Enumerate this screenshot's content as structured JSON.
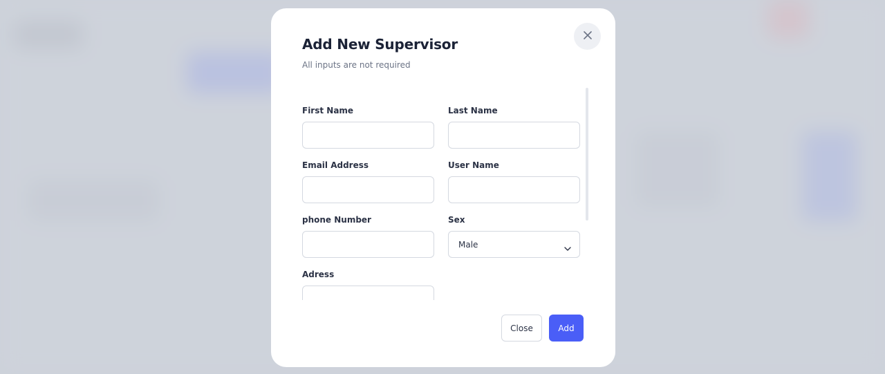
{
  "colors": {
    "accent": "#4a5ef7",
    "title": "#1b2236",
    "subtitle": "#6b7385",
    "border": "#d4d8e0"
  },
  "modal": {
    "title": "Add New Supervisor",
    "subtitle": "All inputs are not required",
    "close_icon": "close-icon"
  },
  "form": {
    "first_name": {
      "label": "First Name",
      "value": ""
    },
    "last_name": {
      "label": "Last Name",
      "value": ""
    },
    "email": {
      "label": "Email Address",
      "value": ""
    },
    "user_name": {
      "label": "User Name",
      "value": ""
    },
    "phone": {
      "label": "phone Number",
      "value": ""
    },
    "sex": {
      "label": "Sex",
      "selected": "Male",
      "icon": "chevron-down-icon"
    },
    "address": {
      "label": "Adress",
      "value": ""
    }
  },
  "actions": {
    "close_label": "Close",
    "add_label": "Add"
  }
}
